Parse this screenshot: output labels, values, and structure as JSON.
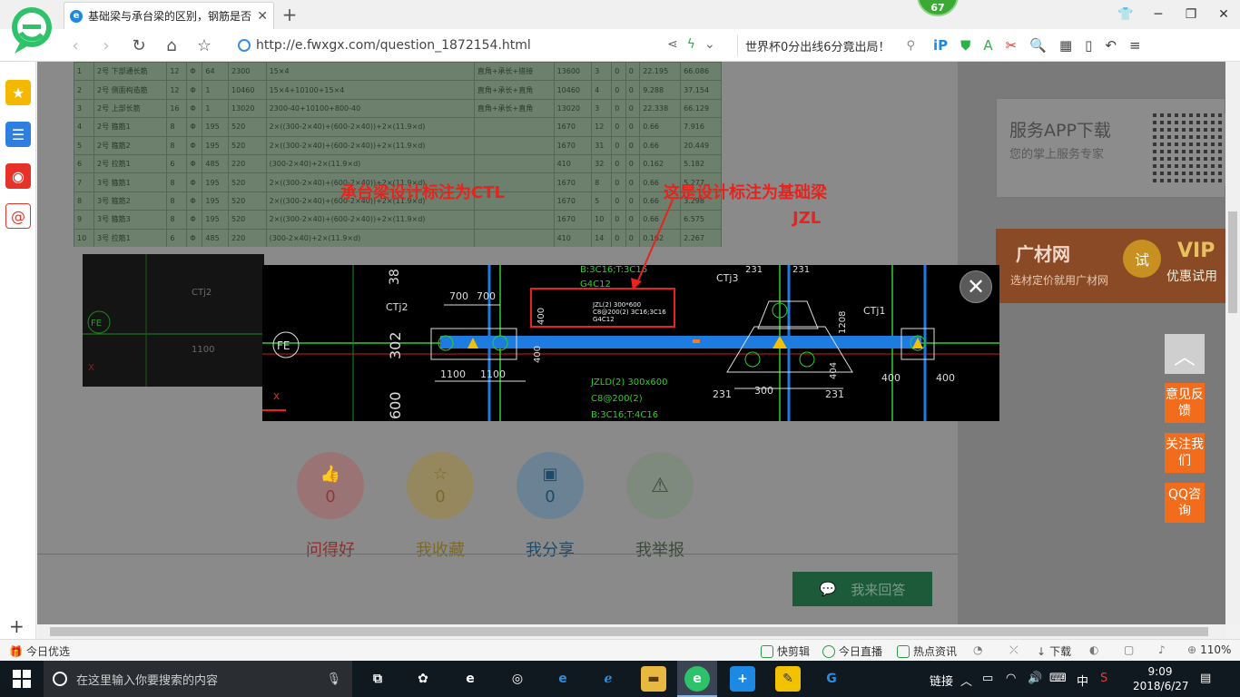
{
  "browser": {
    "tab_title": "基础梁与承台梁的区别，钢筋是否",
    "badge": "67",
    "url": "http://e.fwxgx.com/question_1872154.html",
    "search_text": "世界杯0分出线6分竟出局！",
    "zoom": "110%"
  },
  "sheet": {
    "rows": [
      [
        "1",
        "2号 下部通长筋",
        "12",
        "Φ",
        "64",
        "2300",
        "15×4",
        "直角+承长+搭接",
        "13600",
        "3",
        "0",
        "0",
        "22.195",
        "66.086"
      ],
      [
        "2",
        "2号 侧面构造筋",
        "12",
        "Φ",
        "1",
        "10460",
        "15×4+10100+15×4",
        "直角+承长+直角",
        "10460",
        "4",
        "0",
        "0",
        "9.288",
        "37.154"
      ],
      [
        "3",
        "2号 上部长筋",
        "16",
        "Φ",
        "1",
        "13020",
        "2300-40+10100+800-40",
        "直角+承长+直角",
        "13020",
        "3",
        "0",
        "0",
        "22.338",
        "66.129"
      ],
      [
        "4",
        "2号 箍筋1",
        "8",
        "Φ",
        "195",
        "520",
        "2×((300-2×40)+(600-2×40))+2×(11.9×d)",
        "",
        "1670",
        "12",
        "0",
        "0",
        "0.66",
        "7.916"
      ],
      [
        "5",
        "2号 箍筋2",
        "8",
        "Φ",
        "195",
        "520",
        "2×((300-2×40)+(600-2×40))+2×(11.9×d)",
        "",
        "1670",
        "31",
        "0",
        "0",
        "0.66",
        "20.449"
      ],
      [
        "6",
        "2号 拉筋1",
        "6",
        "Φ",
        "485",
        "220",
        "(300-2×40)+2×(11.9×d)",
        "",
        "410",
        "32",
        "0",
        "0",
        "0.162",
        "5.182"
      ],
      [
        "7",
        "3号 箍筋1",
        "8",
        "Φ",
        "195",
        "520",
        "2×((300-2×40)+(600-2×40))+2×(11.9×d)",
        "",
        "1670",
        "8",
        "0",
        "0",
        "0.66",
        "5.277"
      ],
      [
        "8",
        "3号 箍筋2",
        "8",
        "Φ",
        "195",
        "520",
        "2×((300-2×40)+(600-2×40))+2×(11.9×d)",
        "",
        "1670",
        "5",
        "0",
        "0",
        "0.66",
        "3.298"
      ],
      [
        "9",
        "3号 箍筋3",
        "8",
        "Φ",
        "195",
        "520",
        "2×((300-2×40)+(600-2×40))+2×(11.9×d)",
        "",
        "1670",
        "10",
        "0",
        "0",
        "0.66",
        "6.575"
      ],
      [
        "10",
        "3号 拉筋1",
        "6",
        "Φ",
        "485",
        "220",
        "(300-2×40)+2×(11.9×d)",
        "",
        "410",
        "14",
        "0",
        "0",
        "0.162",
        "2.267"
      ]
    ]
  },
  "cad": {
    "annotation_left": "承台梁设计标注为CTL",
    "annotation_right_1": "这是设计标注为基础梁",
    "annotation_right_2": "JZL",
    "labels": {
      "ctj1": "CTj1",
      "ctj2": "CTj2",
      "ctj3": "CTj3",
      "rebar_top": "B:3C16;T:3C16",
      "g4c12": "G4C12",
      "jzl_box_1": "JZL(2) 300*600",
      "jzl_box_2": "C8@200(2) 3C16;3C16",
      "jzl_box_3": "G4C12",
      "jzld": "JZLD(2) 300x600",
      "c8": "C8@200(2)",
      "b3c16": "B:3C16;T:4C16",
      "d700a": "700",
      "d700b": "700",
      "d400": "400",
      "d302": "302",
      "d38": "38",
      "d600": "600",
      "d1100a": "1100",
      "d1100b": "1100",
      "d231a": "231",
      "d231b": "231",
      "d231c": "231",
      "d231d": "231",
      "d300": "300",
      "d404": "404",
      "d1208": "1208",
      "d400b": "400",
      "d400c": "400",
      "d400d": "400",
      "fe": "FE",
      "x": "x"
    }
  },
  "actions": [
    {
      "label": "问得好",
      "count": "0"
    },
    {
      "label": "我收藏",
      "count": "0"
    },
    {
      "label": "我分享",
      "count": "0"
    },
    {
      "label": "我举报",
      "count": ""
    }
  ],
  "answer_button": "我来回答",
  "sidebar_card": {
    "title": "服务APP下载",
    "subtitle": "您的掌上服务专家"
  },
  "ad": {
    "brand": "广材网",
    "sub": "选材定价就用广材网",
    "try": "试",
    "vip": "VIP",
    "vip_sub": "优惠试用"
  },
  "float": {
    "feedback": "意见反馈",
    "follow": "关注我们",
    "qq": "QQ咨询"
  },
  "statusbar": {
    "left": "今日优选",
    "items": [
      "快剪辑",
      "今日直播",
      "热点资讯",
      "下载"
    ],
    "zoom": "110%"
  },
  "taskbar": {
    "search_placeholder": "在这里输入你要搜索的内容",
    "tray_link": "链接",
    "ime": "中",
    "time": "9:09",
    "date": "2018/6/27"
  },
  "colors": {
    "accent_orange": "#f26c1c",
    "annot_red": "#e8231d",
    "cad_blue": "#1e7be0",
    "cad_green": "#22c022"
  }
}
